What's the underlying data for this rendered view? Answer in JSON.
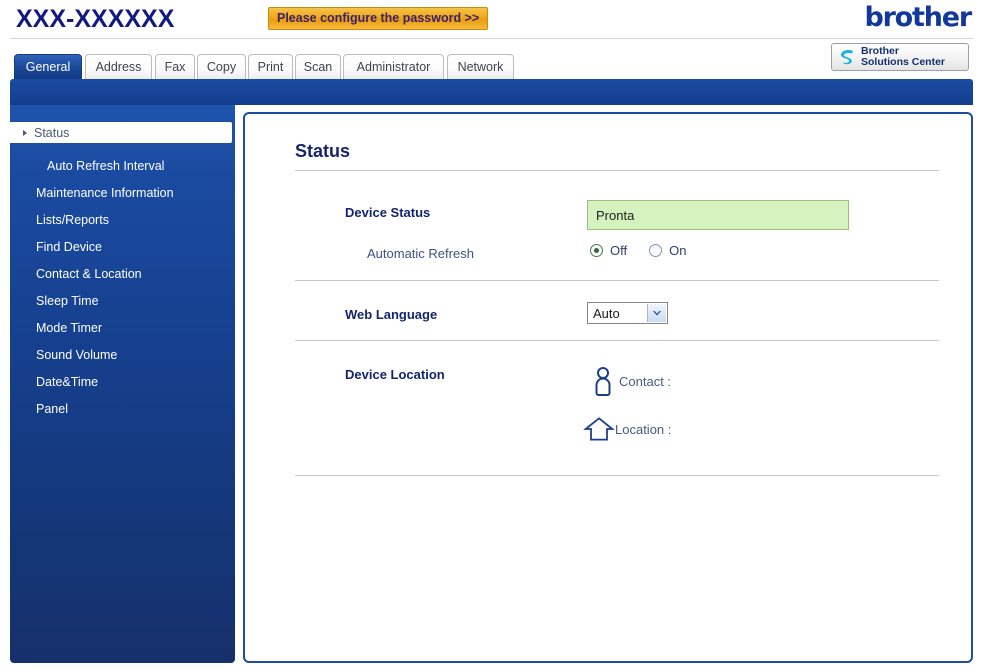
{
  "header": {
    "device_title": "XXX-XXXXXX",
    "password_button": "Please configure the password >>",
    "brand_logo": "brother",
    "solutions_center_line1": "Brother",
    "solutions_center_line2": "Solutions Center",
    "solutions_logo_icon": "brother-s-swirl-icon"
  },
  "tabs": [
    {
      "label": "General",
      "active": true
    },
    {
      "label": "Address",
      "active": false
    },
    {
      "label": "Fax",
      "active": false
    },
    {
      "label": "Copy",
      "active": false
    },
    {
      "label": "Print",
      "active": false
    },
    {
      "label": "Scan",
      "active": false
    },
    {
      "label": "Administrator",
      "active": false
    },
    {
      "label": "Network",
      "active": false
    }
  ],
  "sidebar": {
    "items": [
      {
        "label": "Status",
        "selected": true,
        "sub": false
      },
      {
        "label": "Auto Refresh Interval",
        "selected": false,
        "sub": true
      },
      {
        "label": "Maintenance Information",
        "selected": false,
        "sub": false
      },
      {
        "label": "Lists/Reports",
        "selected": false,
        "sub": false
      },
      {
        "label": "Find Device",
        "selected": false,
        "sub": false
      },
      {
        "label": "Contact & Location",
        "selected": false,
        "sub": false
      },
      {
        "label": "Sleep Time",
        "selected": false,
        "sub": false
      },
      {
        "label": "Mode Timer",
        "selected": false,
        "sub": false
      },
      {
        "label": "Sound Volume",
        "selected": false,
        "sub": false
      },
      {
        "label": "Date&Time",
        "selected": false,
        "sub": false
      },
      {
        "label": "Panel",
        "selected": false,
        "sub": false
      }
    ]
  },
  "main": {
    "page_title": "Status",
    "device_status_label": "Device Status",
    "device_status_value": "Pronta",
    "automatic_refresh_label": "Automatic Refresh",
    "refresh_off_label": "Off",
    "refresh_on_label": "On",
    "refresh_selected": "Off",
    "web_language_label": "Web Language",
    "web_language_value": "Auto",
    "device_location_label": "Device Location",
    "contact_label": "Contact :",
    "contact_icon": "person-icon",
    "location_label": "Location :",
    "location_icon": "house-icon"
  },
  "colors": {
    "brand_blue": "#12389c",
    "sidebar_blue": "#16306b",
    "accent_orange": "#f0a818",
    "status_green_bg": "#d5f2bf",
    "panel_border": "#1d4da0"
  }
}
